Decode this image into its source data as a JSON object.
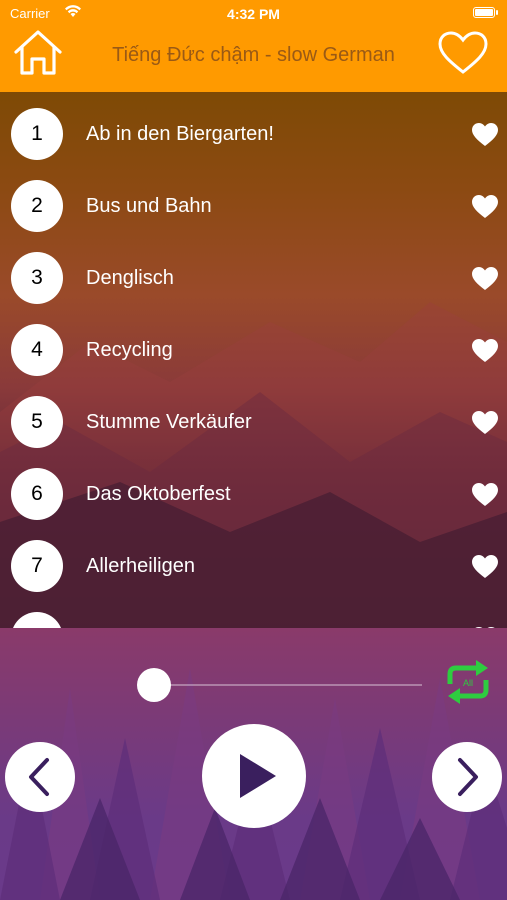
{
  "status_bar": {
    "carrier": "Carrier",
    "time": "4:32 PM"
  },
  "nav": {
    "title": "Tiếng Đức chậm - slow German",
    "home_icon": "house-icon",
    "favorite_icon": "heart-outline-icon"
  },
  "lessons": [
    {
      "number": "1",
      "title": "Ab in den Biergarten!"
    },
    {
      "number": "2",
      "title": "Bus und Bahn"
    },
    {
      "number": "3",
      "title": "Denglisch"
    },
    {
      "number": "4",
      "title": "Recycling"
    },
    {
      "number": "5",
      "title": "Stumme Verkäufer"
    },
    {
      "number": "6",
      "title": "Das Oktoberfest"
    },
    {
      "number": "7",
      "title": "Allerheiligen"
    }
  ],
  "player": {
    "repeat_mode": "All",
    "progress": 0.0,
    "repeat_color": "#2ecc40",
    "control_icons": [
      "chevron-left-icon",
      "play-icon",
      "chevron-right-icon"
    ]
  },
  "colors": {
    "accent": "#ff9a00",
    "nav_title": "#9a5a15",
    "control_glyph": "#3a1f5e"
  }
}
